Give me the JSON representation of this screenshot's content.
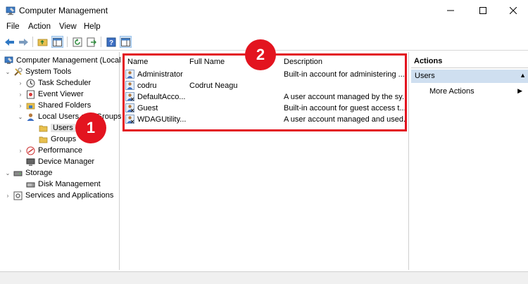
{
  "window": {
    "title": "Computer Management",
    "controls": {
      "minimize_icon": "minimize-icon",
      "maximize_icon": "maximize-icon",
      "close_icon": "close-icon"
    }
  },
  "menu": {
    "items": [
      "File",
      "Action",
      "View",
      "Help"
    ]
  },
  "toolbar": {
    "icons": [
      "back-arrow-icon",
      "forward-arrow-icon",
      "up-folder-icon",
      "show-hide-tree-icon",
      "refresh-icon",
      "export-list-icon",
      "help-icon",
      "properties-icon"
    ]
  },
  "tree": {
    "root": "Computer Management (Local)",
    "system_tools": "System Tools",
    "task_scheduler": "Task Scheduler",
    "event_viewer": "Event Viewer",
    "shared_folders": "Shared Folders",
    "local_users_groups": "Local Users and Groups",
    "users": "Users",
    "groups": "Groups",
    "performance": "Performance",
    "device_manager": "Device Manager",
    "storage": "Storage",
    "disk_management": "Disk Management",
    "services_applications": "Services and Applications"
  },
  "list": {
    "columns": [
      "Name",
      "Full Name",
      "Description"
    ],
    "rows": [
      {
        "name": "Administrator",
        "full_name": "",
        "description": "Built-in account for administering ..."
      },
      {
        "name": "codru",
        "full_name": "Codrut Neagu",
        "description": ""
      },
      {
        "name": "DefaultAcco...",
        "full_name": "",
        "description": "A user account managed by the sy..."
      },
      {
        "name": "Guest",
        "full_name": "",
        "description": "Built-in account for guest access t..."
      },
      {
        "name": "WDAGUtility...",
        "full_name": "",
        "description": "A user account managed and used..."
      }
    ]
  },
  "actions": {
    "title": "Actions",
    "group": "Users",
    "more": "More Actions"
  },
  "annotations": {
    "callout_1": "1",
    "callout_2": "2",
    "color": "#e3141f"
  },
  "colors": {
    "selection": "#e5e5e5",
    "actions_header": "#cfdff0",
    "folder": "#e8c04f"
  }
}
